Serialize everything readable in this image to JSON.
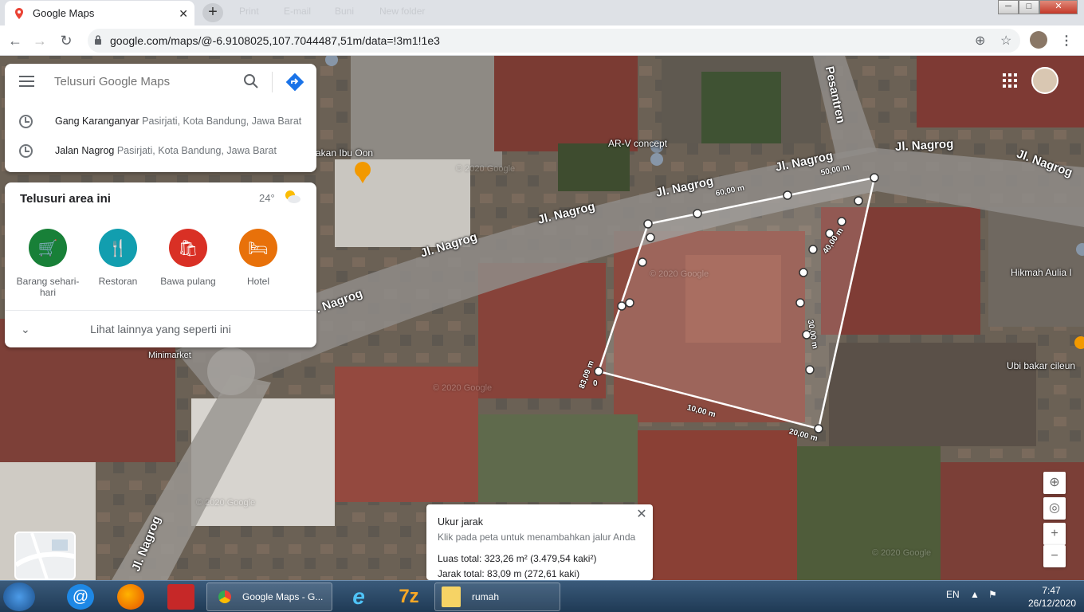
{
  "browser": {
    "tab_title": "Google Maps",
    "new_tab": "+",
    "bookmarks": [
      "Print",
      "E-mail",
      "Buni",
      "New folder"
    ],
    "url": "google.com/maps/@-6.9108025,107.7044487,51m/data=!3m1!1e3",
    "window_controls": {
      "minimize": "─",
      "maximize": "□",
      "close": "✕"
    }
  },
  "search": {
    "placeholder": "Telusuri Google Maps",
    "recent": [
      {
        "name": "Gang Karanganyar",
        "detail": "Pasirjati, Kota Bandung, Jawa Barat"
      },
      {
        "name": "Jalan Nagrog",
        "detail": "Pasirjati, Kota Bandung, Jawa Barat"
      }
    ]
  },
  "explore": {
    "title": "Telusuri area ini",
    "temperature": "24°",
    "categories": [
      {
        "label": "Barang sehari-hari",
        "icon": "cart-icon",
        "color": "#188038"
      },
      {
        "label": "Restoran",
        "icon": "restaurant-icon",
        "color": "#129eaf"
      },
      {
        "label": "Bawa pulang",
        "icon": "takeout-icon",
        "color": "#d93025"
      },
      {
        "label": "Hotel",
        "icon": "hotel-icon",
        "color": "#e8710a"
      }
    ],
    "more": "Lihat lainnya yang seperti ini"
  },
  "map": {
    "roads": [
      "Jl. Nagrog",
      "Jl. Nagrog",
      "Jl. Nagrog",
      "Jl. Nagrog",
      "Jl. Nagrog",
      "Jl. Nagrog",
      "Jl. Nagrog",
      ". Nagrog",
      "Jl. Nagrog",
      "Pesantren"
    ],
    "pois": [
      "AR-V concept",
      "akan Ibu Oon",
      "Hikmah Aulia I",
      "Ubi bakar cileun",
      "Minimarket"
    ],
    "measure_labels": [
      "50,00 m",
      "60,00 m",
      "40,00 m",
      "30,00 m",
      "20,00 m",
      "10,00 m",
      "83,09 m",
      "0"
    ],
    "watermarks": [
      "© 2020 Google",
      "© 2020 Google",
      "© 2020 Google",
      "© 2020 Google",
      "© 2020 Google"
    ]
  },
  "measure": {
    "title": "Ukur jarak",
    "hint": "Klik pada peta untuk menambahkan jalur Anda",
    "area": "Luas total: 323,26 m² (3.479,54 kaki²)",
    "distance": "Jarak total: 83,09 m (272,61 kaki)",
    "close": "✕"
  },
  "map_controls": {
    "zoom_in": "+",
    "zoom_out": "−"
  },
  "taskbar": {
    "items": [
      "Google Maps - G...",
      "rumah"
    ],
    "language": "EN",
    "time": "7:47",
    "date": "26/12/2020"
  }
}
